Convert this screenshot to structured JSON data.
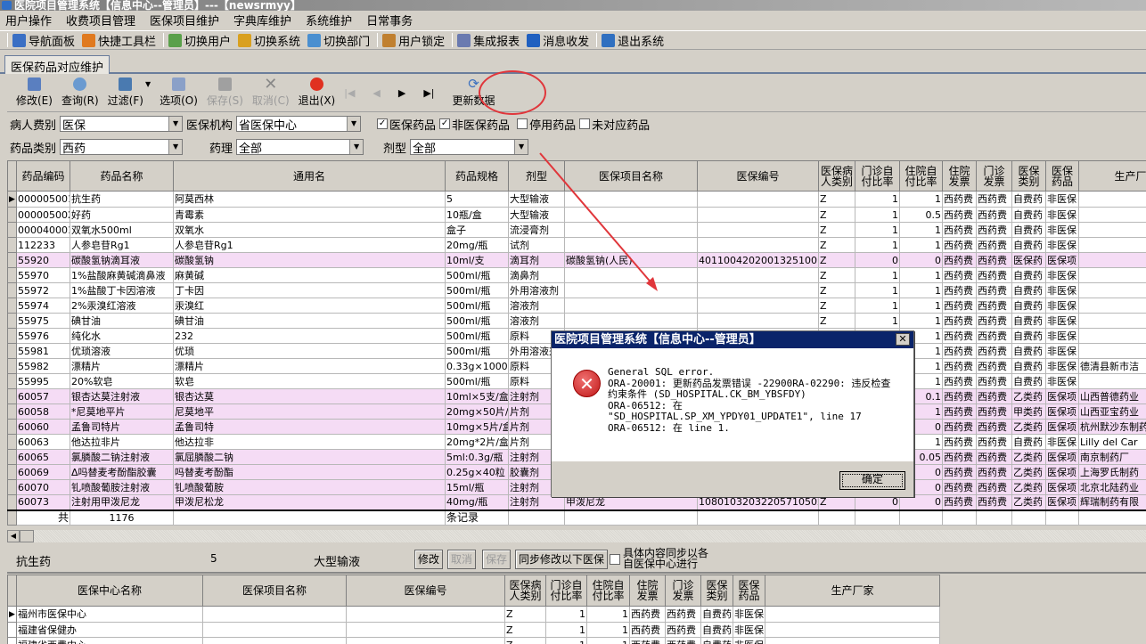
{
  "window": {
    "title": "医院项目管理系统【信息中心--管理员】---【newsrmyy】"
  },
  "menu": [
    "用户操作",
    "收费项目管理",
    "医保项目维护",
    "字典库维护",
    "系统维护",
    "日常事务"
  ],
  "toolbar": [
    {
      "label": "导航面板",
      "icon": "navigation-panel-icon",
      "color": "#3a6fc4"
    },
    {
      "label": "快捷工具栏",
      "icon": "quick-toolbar-icon",
      "color": "#e07a20"
    },
    {
      "label": "切换用户",
      "icon": "switch-user-icon",
      "color": "#5aa04a"
    },
    {
      "label": "切换系统",
      "icon": "switch-system-icon",
      "color": "#d9a020"
    },
    {
      "label": "切换部门",
      "icon": "switch-department-icon",
      "color": "#4a8fd0"
    },
    {
      "label": "用户锁定",
      "icon": "user-lock-icon",
      "color": "#c08030"
    },
    {
      "label": "集成报表",
      "icon": "report-icon",
      "color": "#6a7ab0"
    },
    {
      "label": "消息收发",
      "icon": "message-icon",
      "color": "#2060c0"
    },
    {
      "label": "退出系统",
      "icon": "exit-system-icon",
      "color": "#3070c0"
    }
  ],
  "tab": {
    "label": "医保药品对应维护"
  },
  "actions": {
    "edit": "修改(E)",
    "query": "查询(R)",
    "filter": "过滤(F)",
    "options": "选项(O)",
    "save": "保存(S)",
    "cancel": "取消(C)",
    "exit": "退出(X)",
    "refresh": "更新数据"
  },
  "filters": {
    "patient_type_label": "病人费别",
    "patient_type": "医保",
    "agency_label": "医保机构",
    "agency": "省医保中心",
    "chk_insured": {
      "label": "医保药品",
      "checked": true
    },
    "chk_uninsured": {
      "label": "非医保药品",
      "checked": true
    },
    "chk_disabled": {
      "label": "停用药品",
      "checked": false
    },
    "chk_unmatched": {
      "label": "未对应药品",
      "checked": false
    },
    "category_label": "药品类别",
    "category": "西药",
    "pharm_label": "药理",
    "pharm": "全部",
    "form_label": "剂型",
    "form": "全部"
  },
  "grid": {
    "columns": [
      "药品编码",
      "药品名称",
      "通用名",
      "药品规格",
      "剂型",
      "医保项目名称",
      "医保编号",
      "医保病\n人类别",
      "门诊自\n付比率",
      "住院自\n付比率",
      "住院\n发票",
      "门诊\n发票",
      "医保\n类别",
      "医保\n药品",
      "生产厂家"
    ],
    "rows": [
      [
        "000005001",
        "抗生药",
        "阿莫西林",
        "5",
        "大型输液",
        "",
        "",
        "Z",
        "1",
        "1",
        "西药费",
        "西药费",
        "自费药",
        "非医保",
        ""
      ],
      [
        "000005002",
        "好药",
        "青霉素",
        "10瓶/盒",
        "大型输液",
        "",
        "",
        "Z",
        "1",
        "0.5",
        "西药费",
        "西药费",
        "自费药",
        "非医保",
        ""
      ],
      [
        "000040001",
        "双氧水500ml",
        "双氧水",
        "盒子",
        "流浸膏剂",
        "",
        "",
        "Z",
        "1",
        "1",
        "西药费",
        "西药费",
        "自费药",
        "非医保",
        ""
      ],
      [
        "112233",
        "人参皂苷Rg1",
        "人参皂苷Rg1",
        "20mg/瓶",
        "试剂",
        "",
        "",
        "Z",
        "1",
        "1",
        "西药费",
        "西药费",
        "自费药",
        "非医保",
        ""
      ],
      [
        "55920",
        "碳酸氢钠滴耳液",
        "碳酸氢钠",
        "10ml/支",
        "滴耳剂",
        "碳酸氢钠(人民)",
        "40110042020013251001",
        "Z",
        "0",
        "0",
        "西药费",
        "西药费",
        "医保药",
        "医保项",
        ""
      ],
      [
        "55970",
        "1%盐酸麻黄碱滴鼻液",
        "麻黄碱",
        "500ml/瓶",
        "滴鼻剂",
        "",
        "",
        "Z",
        "1",
        "1",
        "西药费",
        "西药费",
        "自费药",
        "非医保",
        ""
      ],
      [
        "55972",
        "1%盐酸丁卡因溶液",
        "丁卡因",
        "500ml/瓶",
        "外用溶液剂",
        "",
        "",
        "Z",
        "1",
        "1",
        "西药费",
        "西药费",
        "自费药",
        "非医保",
        ""
      ],
      [
        "55974",
        "2%汞溴红溶液",
        "汞溴红",
        "500ml/瓶",
        "溶液剂",
        "",
        "",
        "Z",
        "1",
        "1",
        "西药费",
        "西药费",
        "自费药",
        "非医保",
        ""
      ],
      [
        "55975",
        "碘甘油",
        "碘甘油",
        "500ml/瓶",
        "溶液剂",
        "",
        "",
        "Z",
        "1",
        "1",
        "西药费",
        "西药费",
        "自费药",
        "非医保",
        ""
      ],
      [
        "55976",
        "纯化水",
        "232",
        "500ml/瓶",
        "原料",
        "",
        "",
        "",
        "",
        "1",
        "西药费",
        "西药费",
        "自费药",
        "非医保",
        ""
      ],
      [
        "55981",
        "优琐溶液",
        "优琐",
        "500ml/瓶",
        "外用溶液剂",
        "",
        "",
        "",
        "",
        "1",
        "西药费",
        "西药费",
        "自费药",
        "非医保",
        ""
      ],
      [
        "55982",
        "漂精片",
        "漂精片",
        "0.33g×1000",
        "原料",
        "",
        "",
        "",
        "",
        "1",
        "西药费",
        "西药费",
        "自费药",
        "非医保",
        "德清县新市洁"
      ],
      [
        "55995",
        "20%软皂",
        "软皂",
        "500ml/瓶",
        "原料",
        "",
        "",
        "",
        "",
        "1",
        "西药费",
        "西药费",
        "自费药",
        "非医保",
        ""
      ],
      [
        "60057",
        "银杏达莫注射液",
        "银杏达莫",
        "10ml×5支/盒",
        "注射剂",
        "",
        "",
        "",
        "",
        "0.1",
        "西药费",
        "西药费",
        "乙类药",
        "医保项",
        "山西普德药业"
      ],
      [
        "60058",
        "*尼莫地平片",
        "尼莫地平",
        "20mg×50片/盒",
        "片剂",
        "",
        "",
        "",
        "",
        "1",
        "西药费",
        "西药费",
        "甲类药",
        "医保项",
        "山西亚宝药业"
      ],
      [
        "60060",
        "孟鲁司特片",
        "孟鲁司特",
        "10mg×5片/盒",
        "片剂",
        "",
        "",
        "",
        "",
        "0",
        "西药费",
        "西药费",
        "乙类药",
        "医保项",
        "杭州默沙东制药"
      ],
      [
        "60063",
        "他达拉非片",
        "他达拉非",
        "20mg*2片/盒",
        "片剂",
        "",
        "",
        "",
        "",
        "1",
        "西药费",
        "西药费",
        "自费药",
        "非医保",
        "Lilly del Car"
      ],
      [
        "60065",
        "氯膦酸二钠注射液",
        "氯屈膦酸二钠",
        "5ml:0.3g/瓶",
        "注射剂",
        "",
        "",
        "",
        "",
        "0.05",
        "西药费",
        "西药费",
        "乙类药",
        "医保项",
        "南京制药厂"
      ],
      [
        "60069",
        "Δ吗替麦考酚酯胶囊",
        "吗替麦考酚酯",
        "0.25g×40粒",
        "胶囊剂",
        "",
        "",
        "",
        "",
        "0",
        "西药费",
        "西药费",
        "乙类药",
        "医保项",
        "上海罗氏制药"
      ],
      [
        "60070",
        "钆喷酸葡胺注射液",
        "钆喷酸葡胺",
        "15ml/瓶",
        "注射剂",
        "",
        "",
        "",
        "",
        "0",
        "西药费",
        "西药费",
        "乙类药",
        "医保项",
        "北京北陆药业"
      ],
      [
        "60073",
        "注射用甲泼尼龙",
        "甲泼尼松龙",
        "40mg/瓶",
        "注射剂",
        "甲泼尼龙",
        "10801032032205710502",
        "Z",
        "0",
        "0",
        "西药费",
        "西药费",
        "乙类药",
        "医保项",
        "辉瑞制药有限"
      ]
    ],
    "highlighted_rows": [
      4,
      13,
      14,
      15,
      17,
      18,
      19,
      20
    ],
    "summary": {
      "prefix": "共",
      "count": "1176",
      "suffix": "条记录"
    }
  },
  "detail": {
    "name": "抗生药",
    "spec": "5",
    "form": "大型输液",
    "edit": "修改",
    "cancel": "取消",
    "save": "保存",
    "sync": "同步修改以下医保",
    "sync_note": "具体内容同步以各\n自医保中心进行"
  },
  "grid2": {
    "columns": [
      "医保中心名称",
      "医保项目名称",
      "医保编号",
      "医保病\n人类别",
      "门诊自\n付比率",
      "住院自\n付比率",
      "住院\n发票",
      "门诊\n发票",
      "医保\n类别",
      "医保\n药品",
      "生产厂家"
    ],
    "rows": [
      [
        "福州市医保中心",
        "",
        "",
        "Z",
        "1",
        "1",
        "西药费",
        "西药费",
        "自费药",
        "非医保",
        ""
      ],
      [
        "福建省保健办",
        "",
        "",
        "Z",
        "1",
        "1",
        "西药费",
        "西药费",
        "自费药",
        "非医保",
        ""
      ],
      [
        "福建省西费中心",
        "",
        "",
        "Z",
        "1",
        "1",
        "西药费",
        "西药费",
        "自费药",
        "非医保",
        ""
      ]
    ]
  },
  "dialog": {
    "title": "医院项目管理系统【信息中心--管理员】",
    "message": "General SQL error.\nORA-20001: 更新药品发票错误 -22900RA-02290: 违反检查\n约束条件 (SD_HOSPITAL.CK_BM_YBSFDY)\nORA-06512: 在\n\"SD_HOSPITAL.SP_XM_YPDY01_UPDATE1\", line 17\nORA-06512: 在 line 1.",
    "ok": "确定"
  },
  "annotation_color": "#e0363b"
}
